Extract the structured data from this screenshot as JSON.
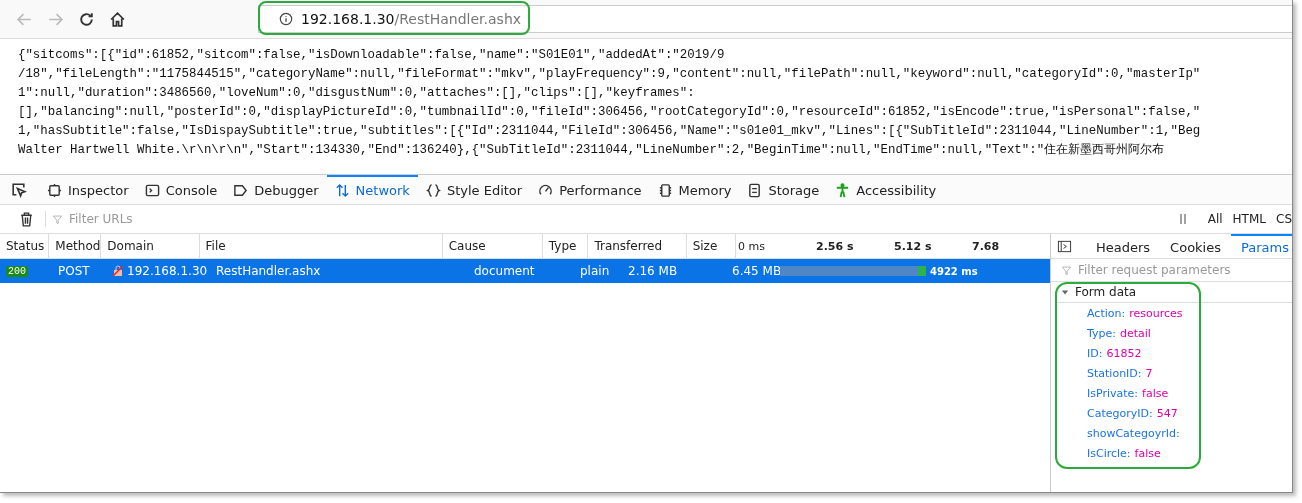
{
  "address_bar": {
    "host": "192.168.1.30",
    "path": "/RestHandler.ashx"
  },
  "response_lines": [
    "{\"sitcoms\":[{\"id\":61852,\"sitcom\":false,\"isDownloadable\":false,\"name\":\"S01E01\",\"addedAt\":\"2019/9",
    "/18\",\"fileLength\":\"1175844515\",\"categoryName\":null,\"fileFormat\":\"mkv\",\"playFrequency\":9,\"content\":null,\"filePath\":null,\"keyword\":null,\"categoryId\":0,\"masterIp\"",
    "1\":null,\"duration\":3486560,\"loveNum\":0,\"disgustNum\":0,\"attaches\":[],\"clips\":[],\"keyframes\":",
    "[],\"balancing\":null,\"posterId\":0,\"displayPictureId\":0,\"tumbnailId\":0,\"fileId\":306456,\"rootCategoryId\":0,\"resourceId\":61852,\"isEncode\":true,\"isPersonal\":false,\"",
    "1,\"hasSubtitle\":false,\"IsDispaySubtitle\":true,\"subtitles\":[{\"Id\":2311044,\"FileId\":306456,\"Name\":\"s01e01_mkv\",\"Lines\":[{\"SubTitleId\":2311044,\"LineNumber\":1,\"Beg",
    "Walter Hartwell White.\\r\\n\\r\\n\",\"Start\":134330,\"End\":136240},{\"SubTitleId\":2311044,\"LineNumber\":2,\"BeginTime\":null,\"EndTime\":null,\"Text\":\"住在新墨西哥州阿尔布"
  ],
  "devtools_tabs": [
    {
      "label": "Inspector",
      "kind": "inspector",
      "selected": false
    },
    {
      "label": "Console",
      "kind": "console",
      "selected": false
    },
    {
      "label": "Debugger",
      "kind": "debugger",
      "selected": false
    },
    {
      "label": "Network",
      "kind": "network",
      "selected": true
    },
    {
      "label": "Style Editor",
      "kind": "style",
      "selected": false
    },
    {
      "label": "Performance",
      "kind": "performance",
      "selected": false
    },
    {
      "label": "Memory",
      "kind": "memory",
      "selected": false
    },
    {
      "label": "Storage",
      "kind": "storage",
      "selected": false
    },
    {
      "label": "Accessibility",
      "kind": "accessibility",
      "selected": false
    }
  ],
  "filter": {
    "placeholder": "Filter URLs"
  },
  "type_filters": [
    "All",
    "HTML",
    "CS"
  ],
  "table": {
    "columns": [
      "Status",
      "Method",
      "Domain",
      "File",
      "Cause",
      "Type",
      "Transferred",
      "Size"
    ],
    "timeline_ticks": [
      "0 ms",
      "2.56 s",
      "5.12 s",
      "7.68"
    ],
    "rows": [
      {
        "status": "200",
        "method": "POST",
        "domain": "192.168.1.30",
        "file": "RestHandler.ashx",
        "cause": "document",
        "type": "plain",
        "transferred": "2.16 MB",
        "size": "6.45 MB",
        "time": "4922 ms",
        "selected": true
      }
    ]
  },
  "details": {
    "tabs": [
      {
        "label": "Headers",
        "selected": false
      },
      {
        "label": "Cookies",
        "selected": false
      },
      {
        "label": "Params",
        "selected": true
      }
    ],
    "filter": {
      "placeholder": "Filter request parameters"
    },
    "section": {
      "title": "Form data",
      "expanded": true
    },
    "params": [
      {
        "key": "Action:",
        "value": "resources"
      },
      {
        "key": "Type:",
        "value": "detail"
      },
      {
        "key": "ID:",
        "value": "61852"
      },
      {
        "key": "StationID:",
        "value": "7"
      },
      {
        "key": "IsPrivate:",
        "value": "false"
      },
      {
        "key": "CategoryID:",
        "value": "547"
      },
      {
        "key": "showCategoyrId:"
      },
      {
        "key": "IsCircle:",
        "value": "false"
      }
    ]
  }
}
